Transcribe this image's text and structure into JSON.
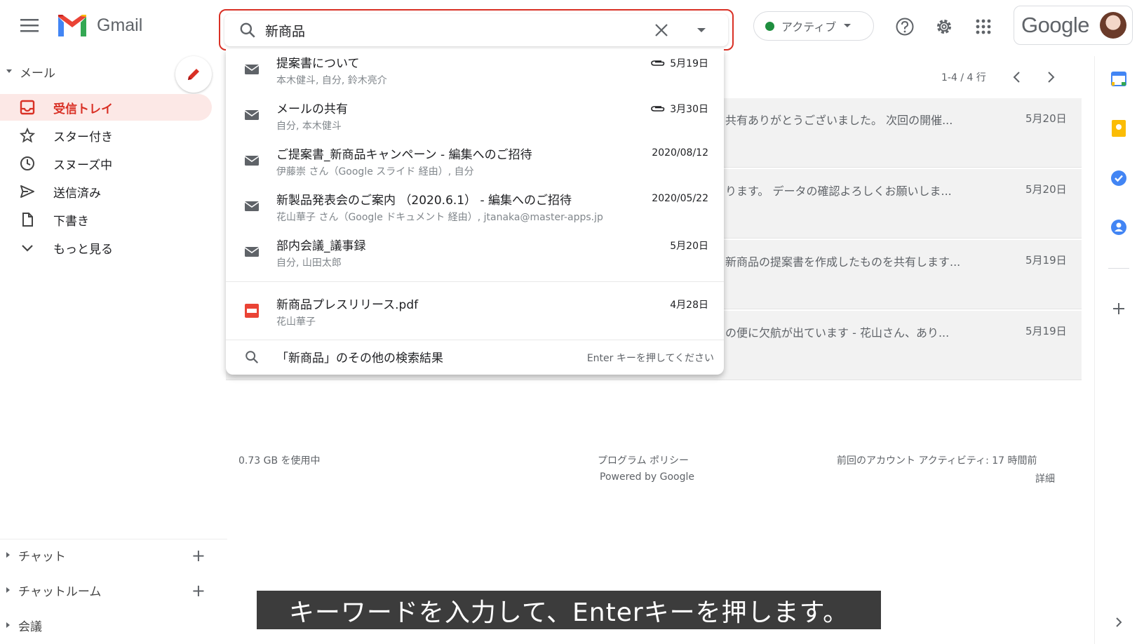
{
  "header": {
    "logo_text": "Gmail",
    "search": {
      "value": "新商品"
    },
    "status_label": "アクティブ",
    "google_wordmark": "Google"
  },
  "sidebar": {
    "mail_section_label": "メール",
    "items": [
      {
        "label": "受信トレイ",
        "icon": "inbox-icon",
        "active": true
      },
      {
        "label": "スター付き",
        "icon": "star-icon"
      },
      {
        "label": "スヌーズ中",
        "icon": "clock-icon"
      },
      {
        "label": "送信済み",
        "icon": "send-icon"
      },
      {
        "label": "下書き",
        "icon": "draft-icon"
      },
      {
        "label": "もっと見る",
        "icon": "chevron-down-icon"
      }
    ],
    "chat_label": "チャット",
    "chatroom_label": "チャットルーム",
    "meet_label": "会議"
  },
  "main": {
    "pager": "1-4 / 4 行",
    "rows": [
      {
        "snippet": "共有ありがとうございました。 次回の開催...",
        "date": "5月20日"
      },
      {
        "snippet": "ります。 データの確認よろしくお願いしま...",
        "date": "5月20日"
      },
      {
        "snippet": "新商品の提案書を作成したものを共有します...",
        "date": "5月19日"
      },
      {
        "snippet": "の便に欠航が出ています - 花山さん、あり...",
        "date": "5月19日"
      }
    ]
  },
  "footer": {
    "storage": "0.73 GB を使用中",
    "policy": "プログラム ポリシー",
    "powered": "Powered by Google",
    "last_activity": "前回のアカウント アクティビティ: 17 時間前",
    "details": "詳細"
  },
  "suggestions": [
    {
      "type": "mail",
      "title": "提案書について",
      "sub": "本木健斗, 自分, 鈴木亮介",
      "date": "5月19日",
      "attachment": true
    },
    {
      "type": "mail",
      "title": "メールの共有",
      "sub": "自分, 本木健斗",
      "date": "3月30日",
      "attachment": true
    },
    {
      "type": "mail",
      "title": "ご提案書_新商品キャンペーン - 編集へのご招待",
      "sub": "伊藤崇 さん（Google スライド 経由）, 自分",
      "date": "2020/08/12",
      "attachment": false
    },
    {
      "type": "mail",
      "title": "新製品発表会のご案内 （2020.6.1） - 編集へのご招待",
      "sub": "花山華子 さん（Google ドキュメント 経由）, jtanaka@master-apps.jp",
      "date": "2020/05/22",
      "attachment": false
    },
    {
      "type": "mail",
      "title": "部内会議_議事録",
      "sub": "自分, 山田太郎",
      "date": "5月20日",
      "attachment": false
    },
    {
      "type": "pdf",
      "title": "新商品プレスリリース.pdf",
      "sub": "花山華子",
      "date": "4月28日",
      "attachment": false
    }
  ],
  "more_results": {
    "label": "「新商品」のその他の検索結果",
    "hint": "Enter キーを押してください"
  },
  "caption": "キーワードを入力して、Enterキーを押します。",
  "colors": {
    "accent_red": "#d93025",
    "active_green": "#1e8e3e"
  }
}
